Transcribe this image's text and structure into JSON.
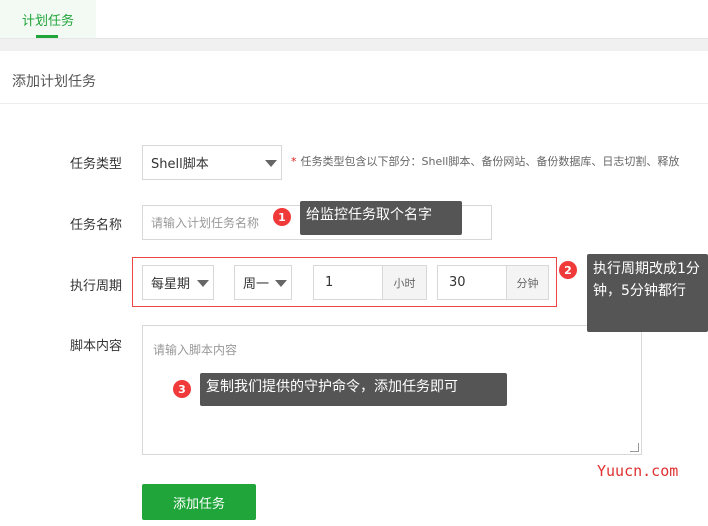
{
  "tabs": [
    {
      "label": "计划任务",
      "active": true
    }
  ],
  "panel": {
    "title": "添加计划任务"
  },
  "form": {
    "task_type": {
      "label": "任务类型",
      "value": "Shell脚本",
      "hint_star": "*",
      "hint": "任务类型包含以下部分：Shell脚本、备份网站、备份数据库、日志切割、释放"
    },
    "task_name": {
      "label": "任务名称",
      "placeholder": "请输入计划任务名称"
    },
    "schedule": {
      "label": "执行周期",
      "period": "每星期",
      "weekday": "周一",
      "hour_value": "1",
      "hour_unit": "小时",
      "minute_value": "30",
      "minute_unit": "分钟"
    },
    "script": {
      "label": "脚本内容",
      "placeholder": "请输入脚本内容"
    },
    "submit_label": "添加任务"
  },
  "annotations": [
    {
      "number": "1",
      "text": "给监控任务取个名字"
    },
    {
      "number": "2",
      "text": "执行周期改成1分钟，5分钟都行"
    },
    {
      "number": "3",
      "text": "复制我们提供的守护命令，添加任务即可"
    }
  ],
  "watermark": "Yuucn.com",
  "colors": {
    "accent": "#20a53a",
    "danger": "#f03a3a",
    "tooltip_bg": "#555555"
  }
}
